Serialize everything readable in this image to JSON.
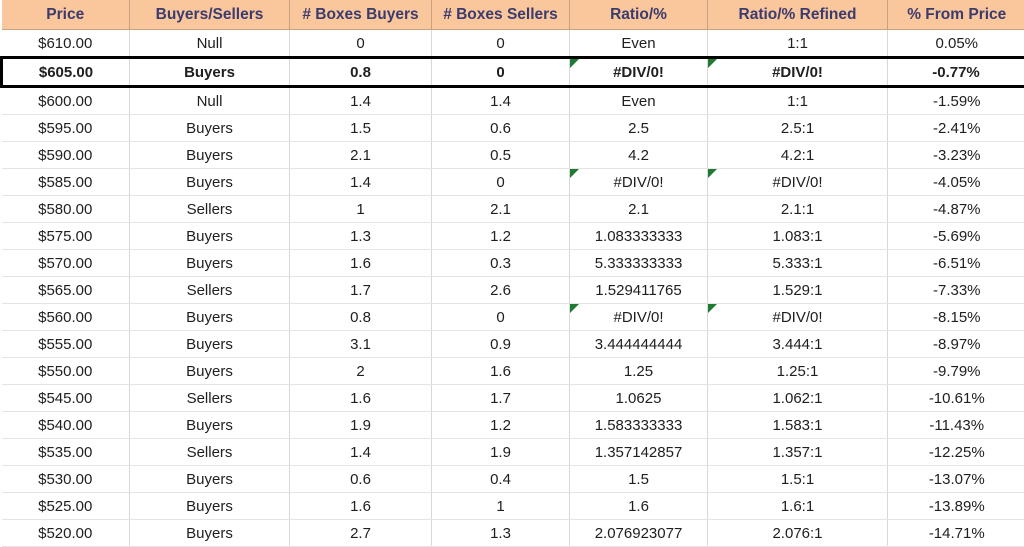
{
  "table": {
    "columns": [
      {
        "key": "price",
        "label": "Price"
      },
      {
        "key": "bs",
        "label": "Buyers/Sellers"
      },
      {
        "key": "boxes_b",
        "label": "# Boxes Buyers"
      },
      {
        "key": "boxes_s",
        "label": "# Boxes Sellers"
      },
      {
        "key": "ratio",
        "label": "Ratio/%"
      },
      {
        "key": "refined",
        "label": "Ratio/% Refined"
      },
      {
        "key": "from",
        "label": "% From Price"
      }
    ],
    "colors": {
      "header_bg": "#fac69b",
      "header_text": "#3b3b6d",
      "buyers_bg": "#c6efce",
      "buyers_text": "#1d6f1d",
      "sellers_bg": "#fdc8ce",
      "sellers_text": "#d62c4a",
      "null_bg": "#fbe5a0",
      "null_text": "#b08114",
      "error_flag": "#1f7a33",
      "gridline": "#d9d9d9",
      "selection_border": "#000000"
    },
    "rows": [
      {
        "price": "$610.00",
        "bs": "Null",
        "status": "null",
        "boxes_b": "0",
        "boxes_s": "0",
        "ratio": "Even",
        "refined": "1:1",
        "from": "0.05%",
        "selected": false,
        "error": false
      },
      {
        "price": "$605.00",
        "bs": "Buyers",
        "status": "buyers",
        "boxes_b": "0.8",
        "boxes_s": "0",
        "ratio": "#DIV/0!",
        "refined": "#DIV/0!",
        "from": "-0.77%",
        "selected": true,
        "error": true
      },
      {
        "price": "$600.00",
        "bs": "Null",
        "status": "null",
        "boxes_b": "1.4",
        "boxes_s": "1.4",
        "ratio": "Even",
        "refined": "1:1",
        "from": "-1.59%",
        "selected": false,
        "error": false
      },
      {
        "price": "$595.00",
        "bs": "Buyers",
        "status": "buyers",
        "boxes_b": "1.5",
        "boxes_s": "0.6",
        "ratio": "2.5",
        "refined": "2.5:1",
        "from": "-2.41%",
        "selected": false,
        "error": false
      },
      {
        "price": "$590.00",
        "bs": "Buyers",
        "status": "buyers",
        "boxes_b": "2.1",
        "boxes_s": "0.5",
        "ratio": "4.2",
        "refined": "4.2:1",
        "from": "-3.23%",
        "selected": false,
        "error": false
      },
      {
        "price": "$585.00",
        "bs": "Buyers",
        "status": "buyers",
        "boxes_b": "1.4",
        "boxes_s": "0",
        "ratio": "#DIV/0!",
        "refined": "#DIV/0!",
        "from": "-4.05%",
        "selected": false,
        "error": true
      },
      {
        "price": "$580.00",
        "bs": "Sellers",
        "status": "sellers",
        "boxes_b": "1",
        "boxes_s": "2.1",
        "ratio": "2.1",
        "refined": "2.1:1",
        "from": "-4.87%",
        "selected": false,
        "error": false
      },
      {
        "price": "$575.00",
        "bs": "Buyers",
        "status": "buyers",
        "boxes_b": "1.3",
        "boxes_s": "1.2",
        "ratio": "1.083333333",
        "refined": "1.083:1",
        "from": "-5.69%",
        "selected": false,
        "error": false
      },
      {
        "price": "$570.00",
        "bs": "Buyers",
        "status": "buyers",
        "boxes_b": "1.6",
        "boxes_s": "0.3",
        "ratio": "5.333333333",
        "refined": "5.333:1",
        "from": "-6.51%",
        "selected": false,
        "error": false
      },
      {
        "price": "$565.00",
        "bs": "Sellers",
        "status": "sellers",
        "boxes_b": "1.7",
        "boxes_s": "2.6",
        "ratio": "1.529411765",
        "refined": "1.529:1",
        "from": "-7.33%",
        "selected": false,
        "error": false
      },
      {
        "price": "$560.00",
        "bs": "Buyers",
        "status": "buyers",
        "boxes_b": "0.8",
        "boxes_s": "0",
        "ratio": "#DIV/0!",
        "refined": "#DIV/0!",
        "from": "-8.15%",
        "selected": false,
        "error": true
      },
      {
        "price": "$555.00",
        "bs": "Buyers",
        "status": "buyers",
        "boxes_b": "3.1",
        "boxes_s": "0.9",
        "ratio": "3.444444444",
        "refined": "3.444:1",
        "from": "-8.97%",
        "selected": false,
        "error": false
      },
      {
        "price": "$550.00",
        "bs": "Buyers",
        "status": "buyers",
        "boxes_b": "2",
        "boxes_s": "1.6",
        "ratio": "1.25",
        "refined": "1.25:1",
        "from": "-9.79%",
        "selected": false,
        "error": false
      },
      {
        "price": "$545.00",
        "bs": "Sellers",
        "status": "sellers",
        "boxes_b": "1.6",
        "boxes_s": "1.7",
        "ratio": "1.0625",
        "refined": "1.062:1",
        "from": "-10.61%",
        "selected": false,
        "error": false
      },
      {
        "price": "$540.00",
        "bs": "Buyers",
        "status": "buyers",
        "boxes_b": "1.9",
        "boxes_s": "1.2",
        "ratio": "1.583333333",
        "refined": "1.583:1",
        "from": "-11.43%",
        "selected": false,
        "error": false
      },
      {
        "price": "$535.00",
        "bs": "Sellers",
        "status": "sellers",
        "boxes_b": "1.4",
        "boxes_s": "1.9",
        "ratio": "1.357142857",
        "refined": "1.357:1",
        "from": "-12.25%",
        "selected": false,
        "error": false
      },
      {
        "price": "$530.00",
        "bs": "Buyers",
        "status": "buyers",
        "boxes_b": "0.6",
        "boxes_s": "0.4",
        "ratio": "1.5",
        "refined": "1.5:1",
        "from": "-13.07%",
        "selected": false,
        "error": false
      },
      {
        "price": "$525.00",
        "bs": "Buyers",
        "status": "buyers",
        "boxes_b": "1.6",
        "boxes_s": "1",
        "ratio": "1.6",
        "refined": "1.6:1",
        "from": "-13.89%",
        "selected": false,
        "error": false
      },
      {
        "price": "$520.00",
        "bs": "Buyers",
        "status": "buyers",
        "boxes_b": "2.7",
        "boxes_s": "1.3",
        "ratio": "2.076923077",
        "refined": "2.076:1",
        "from": "-14.71%",
        "selected": false,
        "error": false
      }
    ]
  }
}
